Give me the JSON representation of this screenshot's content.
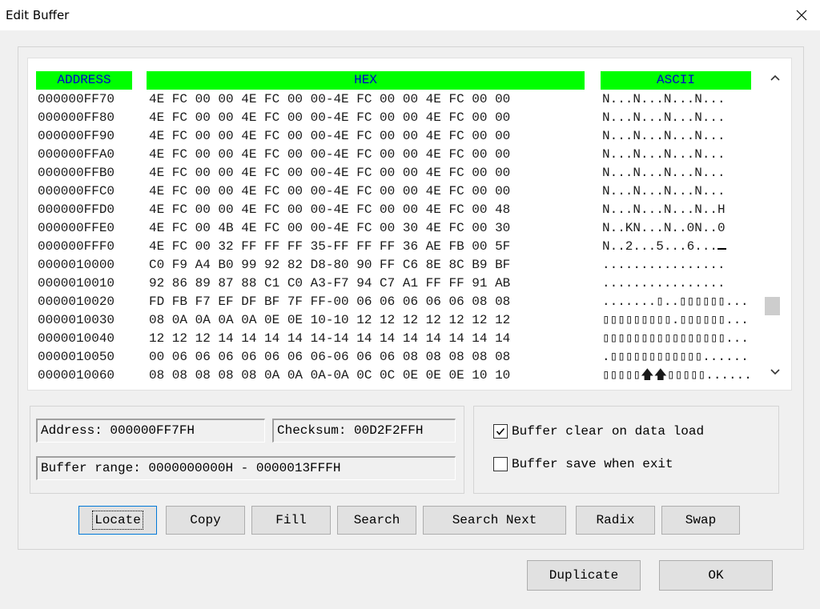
{
  "window": {
    "title": "Edit Buffer"
  },
  "headers": {
    "address": "ADDRESS",
    "hex": "HEX",
    "ascii": "ASCII"
  },
  "rows": [
    {
      "addr": "000000FF70",
      "hex": "4E FC 00 00 4E FC 00 00-4E FC 00 00 4E FC 00 00",
      "ascii": "N...N...N...N..."
    },
    {
      "addr": "000000FF80",
      "hex": "4E FC 00 00 4E FC 00 00-4E FC 00 00 4E FC 00 00",
      "ascii": "N...N...N...N..."
    },
    {
      "addr": "000000FF90",
      "hex": "4E FC 00 00 4E FC 00 00-4E FC 00 00 4E FC 00 00",
      "ascii": "N...N...N...N..."
    },
    {
      "addr": "000000FFA0",
      "hex": "4E FC 00 00 4E FC 00 00-4E FC 00 00 4E FC 00 00",
      "ascii": "N...N...N...N..."
    },
    {
      "addr": "000000FFB0",
      "hex": "4E FC 00 00 4E FC 00 00-4E FC 00 00 4E FC 00 00",
      "ascii": "N...N...N...N..."
    },
    {
      "addr": "000000FFC0",
      "hex": "4E FC 00 00 4E FC 00 00-4E FC 00 00 4E FC 00 00",
      "ascii": "N...N...N...N..."
    },
    {
      "addr": "000000FFD0",
      "hex": "4E FC 00 00 4E FC 00 00-4E FC 00 00 4E FC 00 48",
      "ascii": "N...N...N...N..H"
    },
    {
      "addr": "000000FFE0",
      "hex": "4E FC 00 4B 4E FC 00 00-4E FC 00 30 4E FC 00 30",
      "ascii": "N..KN...N..0N..0"
    },
    {
      "addr": "000000FFF0",
      "hex": "4E FC 00 32 FF FF FF 35-FF FF FF 36 AE FB 00 5F",
      "ascii": "N..2...5...6..."
    },
    {
      "addr": "0000010000",
      "hex": "C0 F9 A4 B0 99 92 82 D8-80 90 FF C6 8E 8C B9 BF",
      "ascii": "................"
    },
    {
      "addr": "0000010010",
      "hex": "92 86 89 87 88 C1 C0 A3-F7 94 C7 A1 FF FF 91 AB",
      "ascii": "................"
    },
    {
      "addr": "0000010020",
      "hex": "FD FB F7 EF DF BF 7F FF-00 06 06 06 06 06 08 08",
      "ascii": ".......▯..▯▯▯▯▯▯..."
    },
    {
      "addr": "0000010030",
      "hex": "08 0A 0A 0A 0A 0E 0E 10-10 12 12 12 12 12 12 12",
      "ascii": "▯▯▯▯▯▯▯▯▯.▯▯▯▯▯▯..."
    },
    {
      "addr": "0000010040",
      "hex": "12 12 12 14 14 14 14 14-14 14 14 14 14 14 14 14",
      "ascii": "▯▯▯▯▯▯▯▯▯▯▯▯▯▯▯▯..."
    },
    {
      "addr": "0000010050",
      "hex": "00 06 06 06 06 06 06 06-06 06 06 08 08 08 08 08",
      "ascii": ".▯▯▯▯▯▯▯▯▯▯▯▯......"
    },
    {
      "addr": "0000010060",
      "hex": "08 08 08 08 08 0A 0A 0A-0A 0C 0C 0E 0E 0E 10 10",
      "ascii": "▯▯▯▯▯🡅🡅▯▯▯▯▯......"
    }
  ],
  "info": {
    "address": "Address: 000000FF7FH",
    "checksum": "Checksum: 00D2F2FFH",
    "range": "Buffer range: 0000000000H - 0000013FFFH"
  },
  "options": {
    "clear_on_load": {
      "label": "Buffer clear on data load",
      "checked": true
    },
    "save_on_exit": {
      "label": "Buffer save when exit",
      "checked": false
    }
  },
  "buttons": {
    "locate": "Locate",
    "copy": "Copy",
    "fill": "Fill",
    "search": "Search",
    "search_next": "Search Next",
    "radix": "Radix",
    "swap": "Swap",
    "duplicate": "Duplicate",
    "ok": "OK"
  },
  "colors": {
    "header_bg": "#00ff00",
    "header_text": "#0000cc"
  }
}
